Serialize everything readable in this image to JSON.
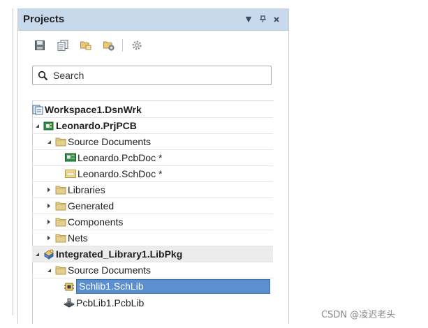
{
  "panel": {
    "title": "Projects"
  },
  "search": {
    "placeholder": "Search"
  },
  "tree": [
    {
      "label": "Workspace1.DsnWrk",
      "bold": true
    },
    {
      "label": "Leonardo.PrjPCB",
      "bold": true
    },
    {
      "label": "Source Documents"
    },
    {
      "label": "Leonardo.PcbDoc *"
    },
    {
      "label": "Leonardo.SchDoc *"
    },
    {
      "label": "Libraries"
    },
    {
      "label": "Generated"
    },
    {
      "label": "Components"
    },
    {
      "label": "Nets"
    },
    {
      "label": "Integrated_Library1.LibPkg",
      "bold": true
    },
    {
      "label": "Source Documents"
    },
    {
      "label": "Schlib1.SchLib",
      "selected": true
    },
    {
      "label": "PcbLib1.PcbLib"
    }
  ],
  "watermark": "CSDN @凌迟老头",
  "colors": {
    "titlebar": "#c9d9ec",
    "selection": "#5b8fd0",
    "folder": "#d9c27a"
  }
}
